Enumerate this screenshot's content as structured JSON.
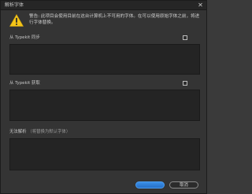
{
  "window": {
    "title": "解析字体",
    "close_symbol": "✕"
  },
  "warning": {
    "icon": "warning-triangle-icon",
    "text": "警告: 此项目会使用目前在这台计算机上不可用的字体。在可以使用原始字体之前，将进行字体替换。",
    "icon_color": "#f5c518"
  },
  "sections": [
    {
      "label": "从 Typekit 同步",
      "hint": ""
    },
    {
      "label": "从 Typekit 获取",
      "hint": ""
    },
    {
      "label": "无法解析",
      "hint": "（将替换为默认字体）"
    }
  ],
  "buttons": {
    "ok": "",
    "cancel": "取消"
  },
  "colors": {
    "accent": "#2d7fd9",
    "panel_bg": "#242424",
    "dialog_bg": "#343434"
  }
}
